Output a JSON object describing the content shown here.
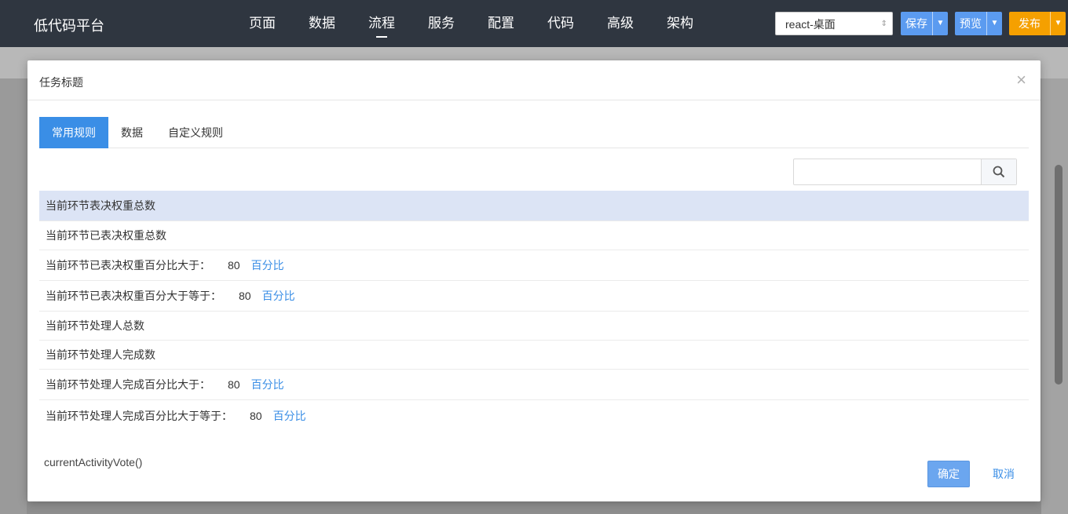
{
  "app": {
    "brand": "低代码平台",
    "nav": [
      {
        "label": "页面"
      },
      {
        "label": "数据"
      },
      {
        "label": "流程",
        "active": true
      },
      {
        "label": "服务"
      },
      {
        "label": "配置"
      },
      {
        "label": "代码"
      },
      {
        "label": "高级"
      },
      {
        "label": "架构"
      }
    ],
    "env_select": {
      "value": "react-桌面"
    },
    "buttons": {
      "save": "保存",
      "preview": "预览",
      "publish": "发布"
    },
    "colors": {
      "topbar": "#2f3640",
      "primary": "#3a8ee6",
      "publish": "#f5a000",
      "selected_row": "#dce4f5"
    }
  },
  "modal": {
    "title": "任务标题",
    "close_icon": "close-icon",
    "tabs": [
      {
        "label": "常用规则",
        "active": true
      },
      {
        "label": "数据"
      },
      {
        "label": "自定义规则"
      }
    ],
    "search": {
      "placeholder": "",
      "value": "",
      "icon": "search-icon"
    },
    "rules": [
      {
        "label": "当前环节表决权重总数",
        "selected": true
      },
      {
        "label": "当前环节已表决权重总数"
      },
      {
        "label": "当前环节已表决权重百分比大于：",
        "value": "80",
        "unit": "百分比"
      },
      {
        "label": "当前环节已表决权重百分大于等于：",
        "value": "80",
        "unit": "百分比"
      },
      {
        "label": "当前环节处理人总数"
      },
      {
        "label": "当前环节处理人完成数"
      },
      {
        "label": "当前环节处理人完成百分比大于：",
        "value": "80",
        "unit": "百分比"
      },
      {
        "label": "当前环节处理人完成百分比大于等于：",
        "value": "80",
        "unit": "百分比"
      }
    ],
    "expression": "currentActivityVote()",
    "ok_label": "确定",
    "cancel_label": "取消"
  }
}
